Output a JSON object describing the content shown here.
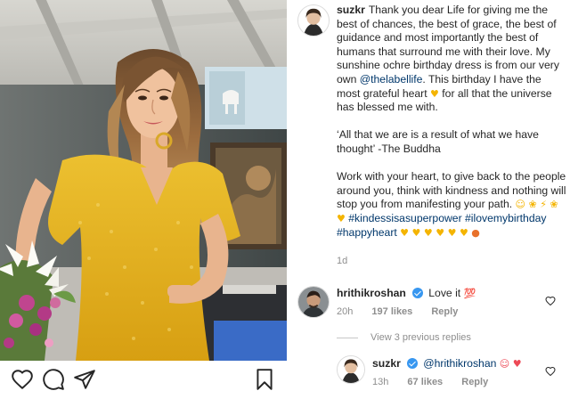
{
  "post": {
    "author": "suzkr",
    "caption_lines": [
      "Thank you dear Life for giving me the best of chances, the best of grace, the best of guidance and most importantly the best of humans that surround me with their love.  My sunshine ochre birthday dress is from our very own",
      "@thelabellife",
      ". This birthday I have the most grateful heart",
      "for all that the universe has blessed me with.",
      "‘All that we are is a result of what we have thought’ -The Buddha",
      "Work with your heart, to give back to the people around you, think with kindness and nothing will stop you from manifesting your path.",
      "#kindessisasuperpower",
      "#ilovemybirthday",
      "#happyheart"
    ],
    "emojis": {
      "heart_yellow": "♥",
      "line_end": "☺ ❀ ⚡ ❀ ♥",
      "hearts_row": "♥ ♥ ♥ ♥ ♥ ♥",
      "balloon": "●"
    },
    "time_ago": "1d"
  },
  "comments": [
    {
      "username": "hrithikroshan",
      "verified": true,
      "text": "Love it",
      "emoji": "💯",
      "time": "20h",
      "likes": "197 likes",
      "reply_label": "Reply"
    },
    {
      "username": "suzkr",
      "verified": true,
      "mention": "@hrithikroshan",
      "emoji": "☺ ♥",
      "time": "13h",
      "likes": "67 likes",
      "reply_label": "Reply"
    }
  ],
  "view_replies_label": "View 3 previous replies",
  "colors": {
    "text": "#262626",
    "secondary": "#8e8e8e",
    "link": "#00376b",
    "verified_blue": "#3897f0",
    "dress_yellow": "#e6b41c"
  },
  "icons": {
    "like": "heart-outline-icon",
    "comment": "comment-bubble-icon",
    "share": "paper-plane-icon",
    "save": "bookmark-icon"
  }
}
